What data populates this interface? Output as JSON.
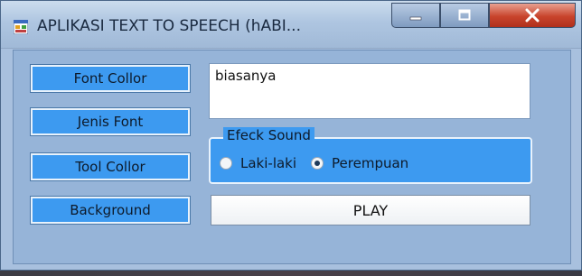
{
  "window": {
    "title": "APLIKASI TEXT TO SPEECH (hABI...",
    "icon": "app-window-icon",
    "controls": {
      "minimize_icon": "minimize-icon",
      "maximize_icon": "maximize-icon",
      "close_icon": "close-icon"
    }
  },
  "buttons": {
    "font_color": "Font Collor",
    "font_type": "Jenis Font",
    "tool_color": "Tool Collor",
    "background": "Background",
    "play": "PLAY"
  },
  "text_input": {
    "value": "biasanya"
  },
  "sound_group": {
    "legend": "Efeck Sound",
    "options": [
      {
        "label": "Laki-laki",
        "checked": false
      },
      {
        "label": "Perempuan",
        "checked": true
      }
    ]
  },
  "colors": {
    "accent_blue": "#3d9af0",
    "window_bg": "#a8c0de",
    "close_red": "#c8442c"
  }
}
